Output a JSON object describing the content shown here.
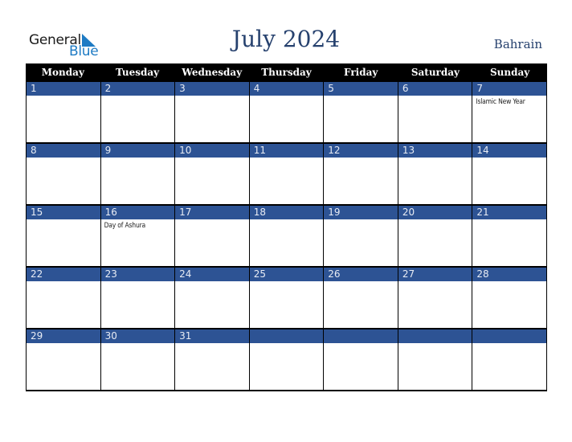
{
  "logo": {
    "line1": "General",
    "line2": "Blue",
    "icon": "triangle-icon",
    "accent": "#1e7bc4"
  },
  "header": {
    "title": "July 2024",
    "country": "Bahrain"
  },
  "colors": {
    "header_bg": "#000000",
    "day_bar": "#2d5394",
    "title": "#26416e"
  },
  "weekdays": [
    "Monday",
    "Tuesday",
    "Wednesday",
    "Thursday",
    "Friday",
    "Saturday",
    "Sunday"
  ],
  "weeks": [
    [
      {
        "day": "1",
        "event": ""
      },
      {
        "day": "2",
        "event": ""
      },
      {
        "day": "3",
        "event": ""
      },
      {
        "day": "4",
        "event": ""
      },
      {
        "day": "5",
        "event": ""
      },
      {
        "day": "6",
        "event": ""
      },
      {
        "day": "7",
        "event": "Islamic New Year"
      }
    ],
    [
      {
        "day": "8",
        "event": ""
      },
      {
        "day": "9",
        "event": ""
      },
      {
        "day": "10",
        "event": ""
      },
      {
        "day": "11",
        "event": ""
      },
      {
        "day": "12",
        "event": ""
      },
      {
        "day": "13",
        "event": ""
      },
      {
        "day": "14",
        "event": ""
      }
    ],
    [
      {
        "day": "15",
        "event": ""
      },
      {
        "day": "16",
        "event": "Day of Ashura"
      },
      {
        "day": "17",
        "event": ""
      },
      {
        "day": "18",
        "event": ""
      },
      {
        "day": "19",
        "event": ""
      },
      {
        "day": "20",
        "event": ""
      },
      {
        "day": "21",
        "event": ""
      }
    ],
    [
      {
        "day": "22",
        "event": ""
      },
      {
        "day": "23",
        "event": ""
      },
      {
        "day": "24",
        "event": ""
      },
      {
        "day": "25",
        "event": ""
      },
      {
        "day": "26",
        "event": ""
      },
      {
        "day": "27",
        "event": ""
      },
      {
        "day": "28",
        "event": ""
      }
    ],
    [
      {
        "day": "29",
        "event": ""
      },
      {
        "day": "30",
        "event": ""
      },
      {
        "day": "31",
        "event": ""
      },
      {
        "day": "",
        "event": ""
      },
      {
        "day": "",
        "event": ""
      },
      {
        "day": "",
        "event": ""
      },
      {
        "day": "",
        "event": ""
      }
    ]
  ]
}
